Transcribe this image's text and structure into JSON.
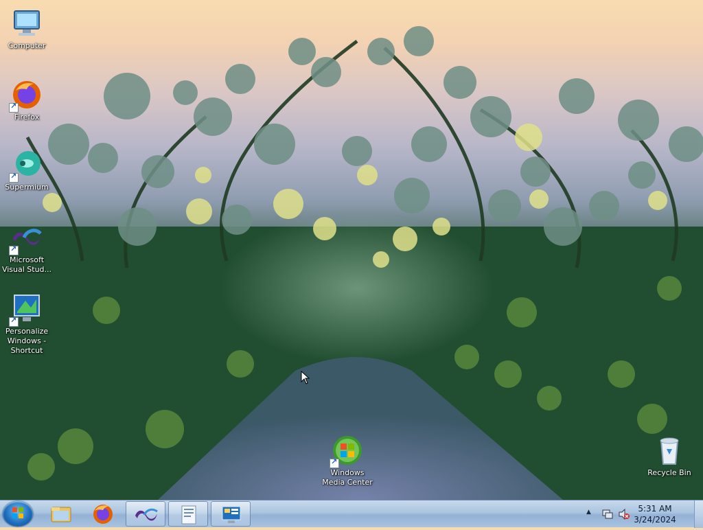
{
  "desktop": {
    "icons": [
      {
        "id": "computer",
        "label": "Computer"
      },
      {
        "id": "firefox",
        "label": "Firefox"
      },
      {
        "id": "supermium",
        "label": "Supermium"
      },
      {
        "id": "vs",
        "label": "Microsoft Visual Stud..."
      },
      {
        "id": "personalize",
        "label": "Personalize Windows - Shortcut"
      },
      {
        "id": "wmc",
        "label": "Windows Media Center"
      },
      {
        "id": "recycle",
        "label": "Recycle Bin"
      }
    ]
  },
  "taskbar": {
    "start_label": "Start",
    "pinned": [
      {
        "id": "explorer",
        "icon": "folder-icon"
      },
      {
        "id": "firefox",
        "icon": "firefox-icon"
      },
      {
        "id": "vs",
        "icon": "visual-studio-icon"
      },
      {
        "id": "wordpad",
        "icon": "document-icon"
      },
      {
        "id": "personalize",
        "icon": "personalize-icon"
      }
    ],
    "tray": {
      "time": "5:31 AM",
      "date": "3/24/2024"
    }
  },
  "colors": {
    "taskbar_top": "#c8d9ec",
    "start_orb": "#1f6fbf",
    "wallpaper_sky": "#f8dcb0",
    "wallpaper_foliage": "#1d4528"
  }
}
